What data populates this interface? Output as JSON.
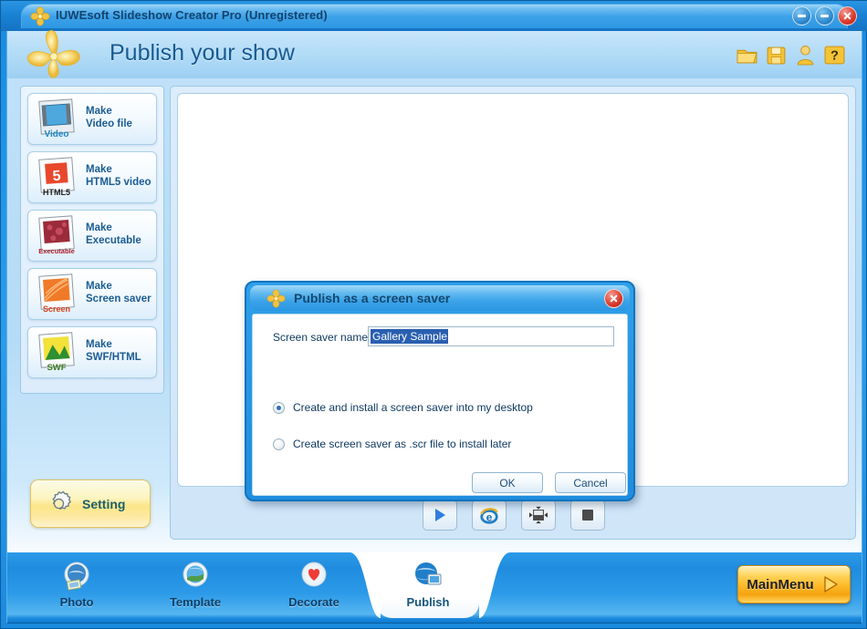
{
  "window": {
    "title": "IUWEsoft Slideshow Creator Pro (Unregistered)",
    "logo_icon": "flower-logo-icon",
    "minimize_icon": "minimize-icon",
    "maximize_icon": "maximize-icon",
    "close_icon": "close-icon",
    "accent_color": "#1f8cdf",
    "frame_color": "#0a5e9e"
  },
  "header": {
    "title": "Publish your show",
    "logo_icon": "flower-logo-icon",
    "icons": [
      {
        "name": "open-folder-icon",
        "tip": "Open"
      },
      {
        "name": "save-icon",
        "tip": "Save"
      },
      {
        "name": "user-icon",
        "tip": "Register"
      },
      {
        "name": "help-icon",
        "tip": "Help"
      }
    ]
  },
  "sidebar": {
    "items": [
      {
        "line1": "Make",
        "line2": "Video file",
        "thumb": "video-file-thumb-icon",
        "badge": "Video"
      },
      {
        "line1": "Make",
        "line2": "HTML5 video",
        "thumb": "html5-video-thumb-icon",
        "badge": "HTML5"
      },
      {
        "line1": "Make",
        "line2": "Executable",
        "thumb": "executable-thumb-icon",
        "badge": "Executable"
      },
      {
        "line1": "Make",
        "line2": "Screen saver",
        "thumb": "screen-saver-thumb-icon",
        "badge": "Screen"
      },
      {
        "line1": "Make",
        "line2": "SWF/HTML",
        "thumb": "swf-html-thumb-icon",
        "badge": "SWF"
      }
    ],
    "setting_label": "Setting",
    "setting_icon": "gear-icon"
  },
  "main": {
    "media_buttons": [
      {
        "name": "play-button",
        "icon": "play-icon"
      },
      {
        "name": "browser-preview-button",
        "icon": "internet-explorer-icon"
      },
      {
        "name": "fullscreen-button",
        "icon": "fullscreen-icon"
      },
      {
        "name": "stop-button",
        "icon": "stop-icon"
      }
    ]
  },
  "tabs": [
    {
      "label": "Photo",
      "icon": "photo-globe-icon",
      "active": false
    },
    {
      "label": "Template",
      "icon": "template-globe-icon",
      "active": false
    },
    {
      "label": "Decorate",
      "icon": "decorate-heart-icon",
      "active": false
    },
    {
      "label": "Publish",
      "icon": "publish-globe-icon",
      "active": true
    }
  ],
  "mainmenu": {
    "label": "MainMenu",
    "arrow_icon": "arrow-right-icon",
    "color": "#fbb524"
  },
  "dialog": {
    "title": "Publish as a screen saver",
    "logo_icon": "flower-logo-icon",
    "close_icon": "close-icon",
    "name_label": "Screen saver name",
    "name_value": "Gallery Sample",
    "name_placeholder": "Screen saver name",
    "options": [
      {
        "label": "Create and install a screen saver into my desktop",
        "selected": true
      },
      {
        "label": "Create screen saver as .scr file to install later",
        "selected": false
      }
    ],
    "ok_label": "OK",
    "cancel_label": "Cancel"
  }
}
